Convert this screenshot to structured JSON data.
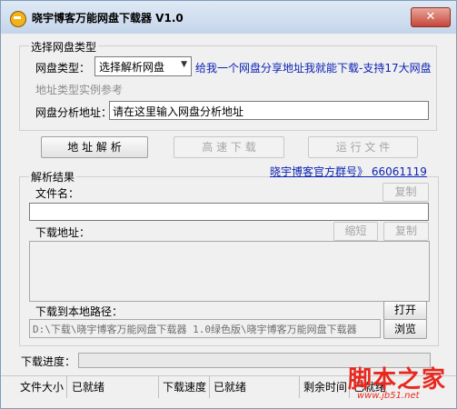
{
  "window": {
    "title": "晓宇博客万能网盘下载器 V1.0",
    "close_label": "✕"
  },
  "select_group": {
    "title": "选择网盘类型",
    "type_label": "网盘类型：",
    "type_value": "选择解析网盘",
    "hint_link": "给我一个网盘分享地址我就能下载-支持17大网盘",
    "example_label": "地址类型实例参考",
    "url_label": "网盘分析地址：",
    "url_value": "请在这里输入网盘分析地址"
  },
  "actions": {
    "parse": "地 址 解 析",
    "fast_download": "高 速 下 载",
    "run_file": "运 行 文 件"
  },
  "result_group": {
    "title": "解析结果",
    "qq_group_link": "晓宇博客官方群号》 66061119",
    "filename_label": "文件名：",
    "copy_label": "复制",
    "filename_value": "",
    "download_url_label": "下载地址：",
    "shorten_label": "缩短",
    "copy2_label": "复制",
    "local_path_label": "下载到本地路径：",
    "open_label": "打开",
    "path_value": "D:\\下载\\晓宇博客万能网盘下载器 1.0绿色版\\晓宇博客万能网盘下载器",
    "browse_label": "浏览"
  },
  "progress": {
    "label": "下载进度：",
    "value": 0
  },
  "status": {
    "size_label": "文件大小",
    "size_value": "已就绪",
    "speed_label": "下载速度",
    "speed_value": "已就绪",
    "remaining_label": "剩余时间",
    "remaining_value": "已就绪"
  },
  "watermark": {
    "main": "脚本之家",
    "sub": "www.jb51.net"
  }
}
